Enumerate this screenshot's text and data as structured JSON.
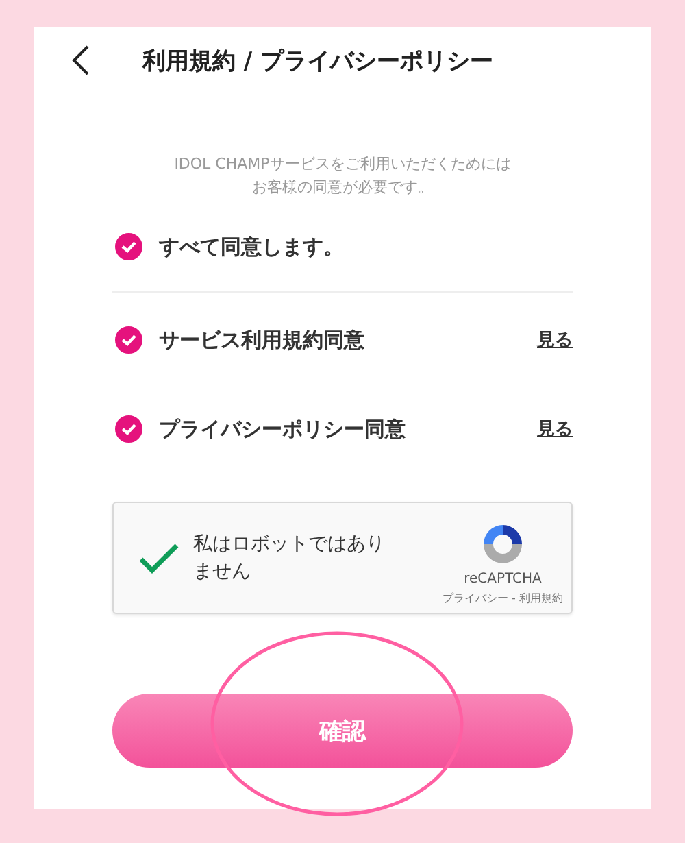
{
  "header": {
    "title": "利用規約 / プライバシーポリシー"
  },
  "description": [
    "IDOL CHAMPサービスをご利用いただくためには",
    "お客様の同意が必要です。"
  ],
  "agree_all": {
    "label": "すべて同意します。",
    "checked": true
  },
  "agreements": [
    {
      "label": "サービス利用規約同意",
      "checked": true,
      "link": "見る"
    },
    {
      "label": "プライバシーポリシー同意",
      "checked": true,
      "link": "見る"
    }
  ],
  "recaptcha": {
    "checked": true,
    "label": "私はロボットではありません",
    "brand": "reCAPTCHA",
    "links": "プライバシー - 利用規約"
  },
  "confirm_button": "確認"
}
